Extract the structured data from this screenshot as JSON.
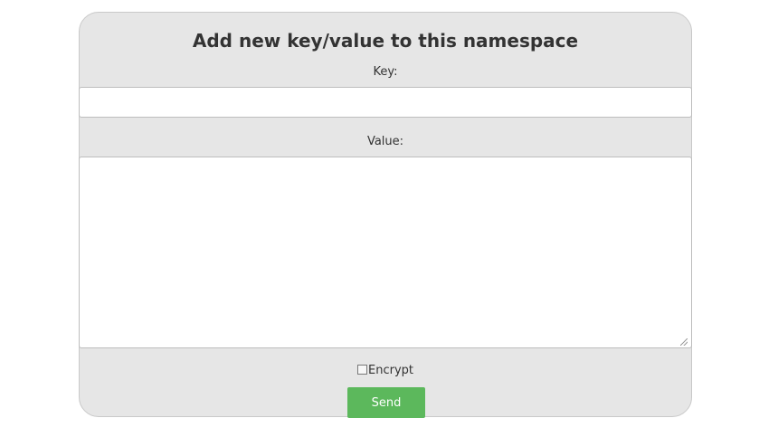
{
  "form": {
    "title": "Add new key/value to this namespace",
    "key_label": "Key:",
    "key_value": "",
    "value_label": "Value:",
    "value_value": "",
    "encrypt_label": "Encrypt",
    "encrypt_checked": false,
    "send_label": "Send"
  },
  "colors": {
    "panel_bg": "#e6e6e6",
    "send_button_bg": "#5cb85c",
    "text": "#333333"
  }
}
